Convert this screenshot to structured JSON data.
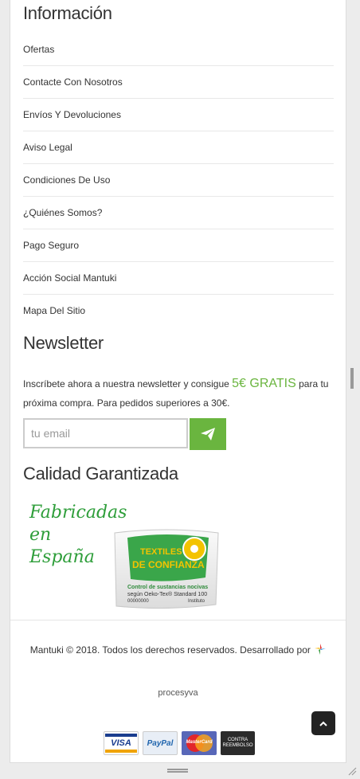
{
  "info": {
    "title": "Información",
    "items": [
      {
        "label": "Ofertas"
      },
      {
        "label": "Contacte Con Nosotros"
      },
      {
        "label": "Envíos Y Devoluciones"
      },
      {
        "label": "Aviso Legal"
      },
      {
        "label": "Condiciones De Uso"
      },
      {
        "label": "¿Quiénes Somos?"
      },
      {
        "label": "Pago Seguro"
      },
      {
        "label": "Acción Social Mantuki"
      },
      {
        "label": "Mapa Del Sitio"
      }
    ]
  },
  "newsletter": {
    "title": "Newsletter",
    "text_before": "Inscríbete ahora a nuestra newsletter y consigue ",
    "promo": "5€ GRATIS",
    "text_after": " para tu próxima compra. Para pedidos superiores a 30€.",
    "email_placeholder": "tu email"
  },
  "quality": {
    "title": "Calidad Garantizada",
    "made_in_line1": "Fabricadas en",
    "made_in_line2": "España",
    "label_line1": "TEXTILES",
    "label_line2": "DE CONFIANZA",
    "label_line3": "Control de sustancias nocivas",
    "label_line4": "según Oeko-Tex® Standard 100",
    "label_number": "00000000",
    "label_institute": "Instituto"
  },
  "footer": {
    "copyright": "Mantuki © 2018. Todos los derechos reservados. Desarrollado por",
    "developer": "procesyva",
    "payments": [
      "VISA",
      "PayPal",
      "MasterCard",
      "CONTRA",
      "REEMBOLSO"
    ]
  },
  "colors": {
    "accent": "#6ab53f",
    "text": "#333333",
    "divider": "#e8e8e8"
  }
}
